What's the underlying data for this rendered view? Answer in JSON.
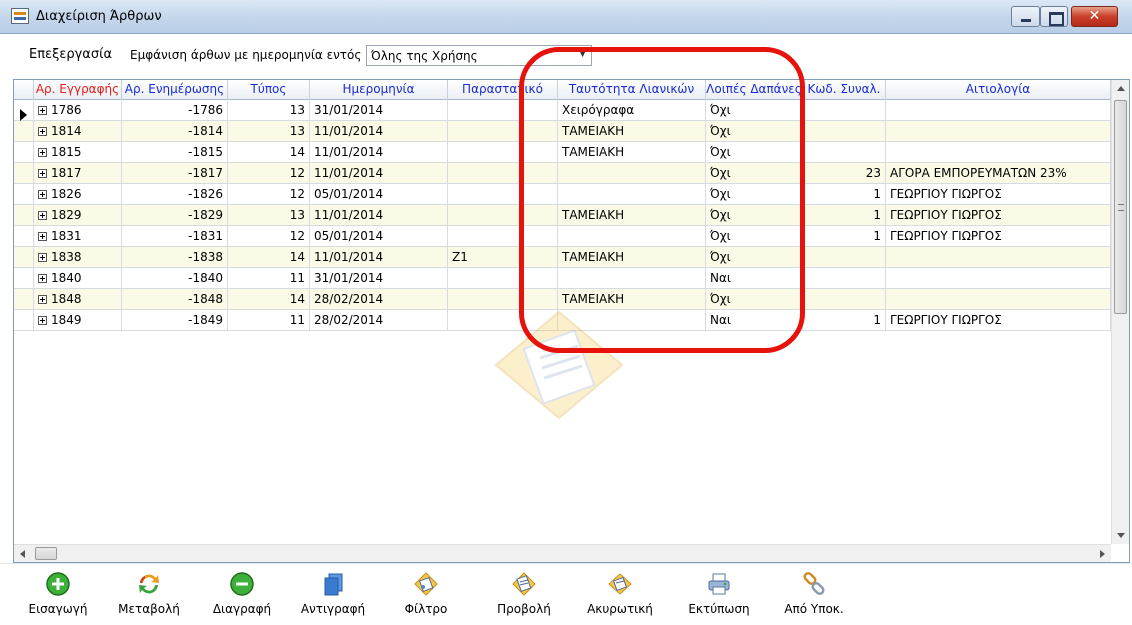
{
  "window": {
    "title": "Διαχείριση Άρθρων"
  },
  "toolbar": {
    "edit_menu": "Επεξεργασία",
    "filter_label": "Εμφάνιση άρθων με ημερομηνία εντός",
    "filter_value": "Όλης της Χρήσης"
  },
  "grid": {
    "columns": [
      "Αρ. Εγγραφής",
      "Αρ. Ενημέρωσης",
      "Τύπος",
      "Ημερομηνία",
      "Παραστατικό",
      "Ταυτότητα Λιανικών",
      "Λοιπές Δαπάνες",
      "Κωδ. Συναλ.",
      "Αιτιολογία"
    ],
    "rows": [
      {
        "reg": "1786",
        "upd": "-1786",
        "type": "13",
        "date": "31/01/2014",
        "doc": "",
        "retail": "Χειρόγραφα",
        "other": "Όχι",
        "code": "",
        "reason": ""
      },
      {
        "reg": "1814",
        "upd": "-1814",
        "type": "13",
        "date": "11/01/2014",
        "doc": "",
        "retail": "ΤΑΜΕΙΑΚΗ",
        "other": "Όχι",
        "code": "",
        "reason": ""
      },
      {
        "reg": "1815",
        "upd": "-1815",
        "type": "14",
        "date": "11/01/2014",
        "doc": "",
        "retail": "ΤΑΜΕΙΑΚΗ",
        "other": "Όχι",
        "code": "",
        "reason": ""
      },
      {
        "reg": "1817",
        "upd": "-1817",
        "type": "12",
        "date": "11/01/2014",
        "doc": "",
        "retail": "",
        "other": "Όχι",
        "code": "23",
        "reason": "ΑΓΟΡΑ ΕΜΠΟΡΕΥΜΑΤΩΝ 23%"
      },
      {
        "reg": "1826",
        "upd": "-1826",
        "type": "12",
        "date": "05/01/2014",
        "doc": "",
        "retail": "",
        "other": "Όχι",
        "code": "1",
        "reason": "ΓΕΩΡΓΙΟΥ ΓΙΩΡΓΟΣ"
      },
      {
        "reg": "1829",
        "upd": "-1829",
        "type": "13",
        "date": "11/01/2014",
        "doc": "",
        "retail": "ΤΑΜΕΙΑΚΗ",
        "other": "Όχι",
        "code": "1",
        "reason": "ΓΕΩΡΓΙΟΥ ΓΙΩΡΓΟΣ"
      },
      {
        "reg": "1831",
        "upd": "-1831",
        "type": "12",
        "date": "05/01/2014",
        "doc": "",
        "retail": "",
        "other": "Όχι",
        "code": "1",
        "reason": "ΓΕΩΡΓΙΟΥ ΓΙΩΡΓΟΣ"
      },
      {
        "reg": "1838",
        "upd": "-1838",
        "type": "14",
        "date": "11/01/2014",
        "doc": "Z1",
        "retail": "ΤΑΜΕΙΑΚΗ",
        "other": "Όχι",
        "code": "",
        "reason": ""
      },
      {
        "reg": "1840",
        "upd": "-1840",
        "type": "11",
        "date": "31/01/2014",
        "doc": "",
        "retail": "",
        "other": "Ναι",
        "code": "",
        "reason": ""
      },
      {
        "reg": "1848",
        "upd": "-1848",
        "type": "14",
        "date": "28/02/2014",
        "doc": "",
        "retail": "ΤΑΜΕΙΑΚΗ",
        "other": "Όχι",
        "code": "",
        "reason": ""
      },
      {
        "reg": "1849",
        "upd": "-1849",
        "type": "11",
        "date": "28/02/2014",
        "doc": "",
        "retail": "",
        "other": "Ναι",
        "code": "1",
        "reason": "ΓΕΩΡΓΙΟΥ ΓΙΩΡΓΟΣ"
      }
    ]
  },
  "buttons": [
    {
      "label": "Εισαγωγή",
      "icon": "plus-circle-icon"
    },
    {
      "label": "Μεταβολή",
      "icon": "refresh-arrows-icon"
    },
    {
      "label": "Διαγραφή",
      "icon": "minus-circle-icon"
    },
    {
      "label": "Αντιγραφή",
      "icon": "copy-documents-icon"
    },
    {
      "label": "Φίλτρο",
      "icon": "filter-clipboard-icon"
    },
    {
      "label": "Προβολή",
      "icon": "view-document-icon"
    },
    {
      "label": "Ακυρωτική",
      "icon": "cancel-document-icon"
    },
    {
      "label": "Εκτύπωση",
      "icon": "printer-icon"
    },
    {
      "label": "Από Υποκ.",
      "icon": "chain-link-icon"
    }
  ],
  "colors": {
    "header_text": "#1a2bd6",
    "header_highlight": "#e8201a",
    "alt_row": "#fafae6",
    "highlight_ring": "#e6120c"
  }
}
